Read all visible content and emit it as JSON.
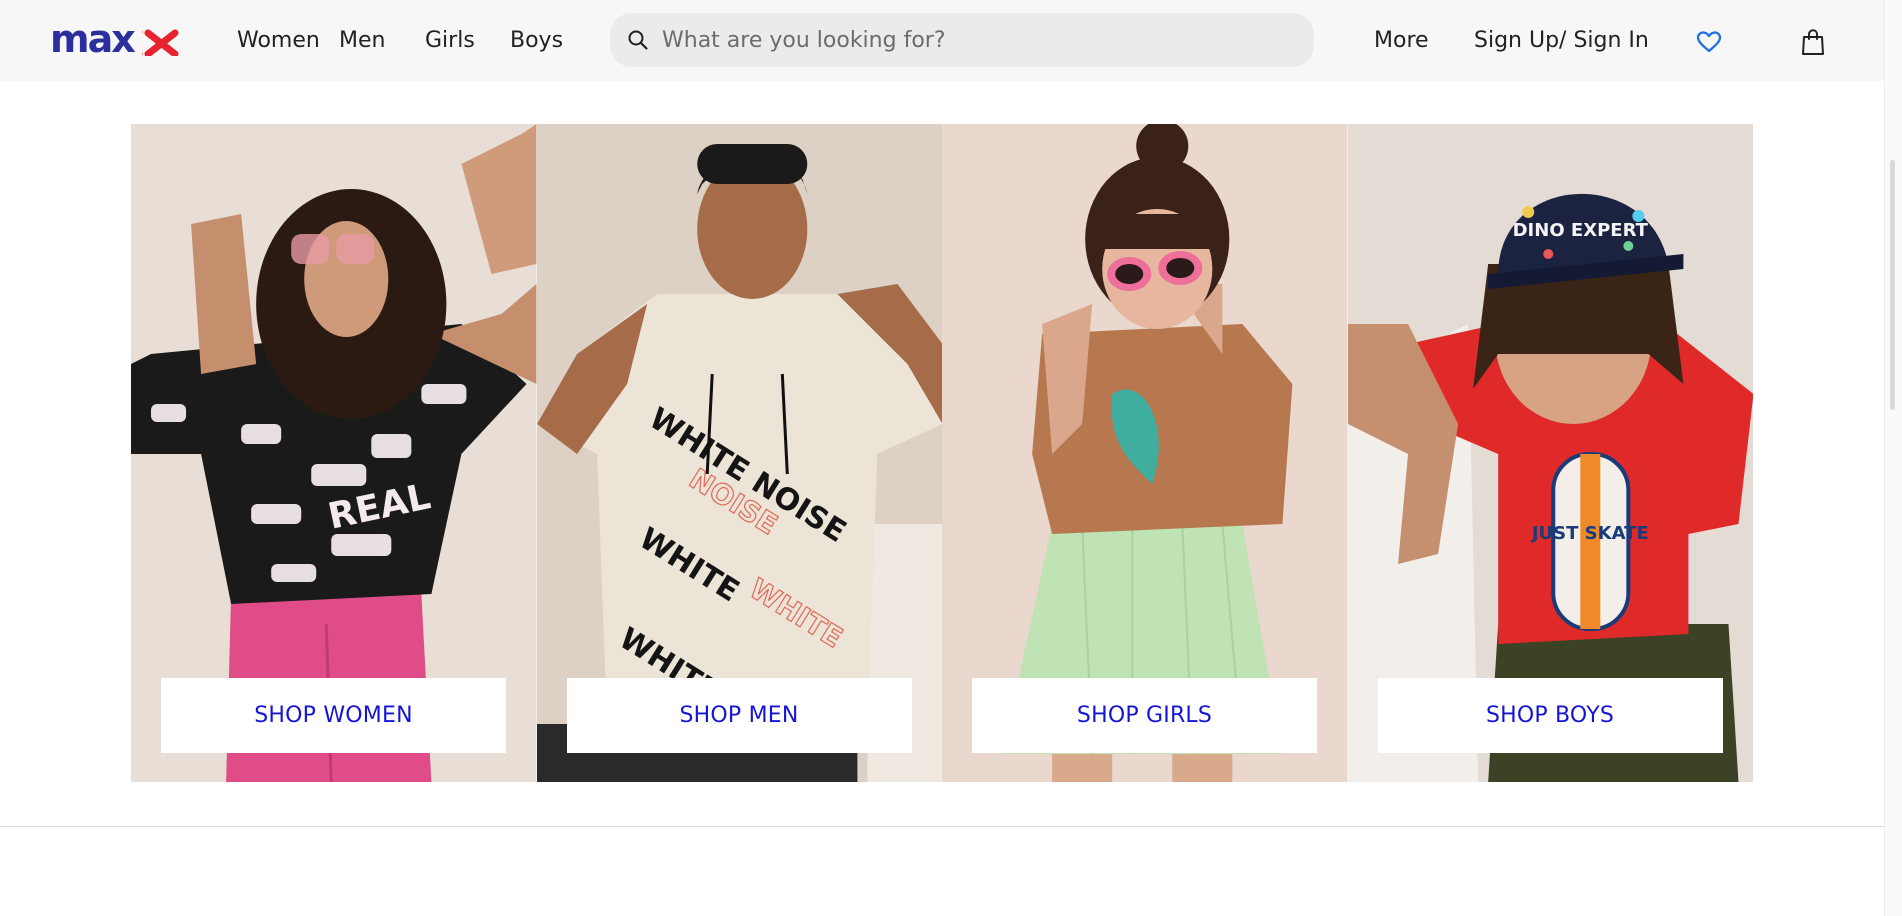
{
  "header": {
    "logo_text": "max",
    "nav": [
      {
        "label": "Women"
      },
      {
        "label": "Men"
      },
      {
        "label": "Girls"
      },
      {
        "label": "Boys"
      }
    ],
    "search": {
      "placeholder": "What are you looking for?",
      "value": ""
    },
    "more_label": "More",
    "signin_label": "Sign Up/ Sign In",
    "icons": {
      "search": "search-icon",
      "wishlist": "heart-icon",
      "cart": "shopping-bag-icon"
    }
  },
  "tiles": [
    {
      "button_label": "SHOP WOMEN",
      "print_text": "REAL"
    },
    {
      "button_label": "SHOP MEN",
      "print_text": "WHITE NOISE"
    },
    {
      "button_label": "SHOP GIRLS"
    },
    {
      "button_label": "SHOP BOYS",
      "cap_text": "DINO EXPERT",
      "tee_text": "JUST SKATE"
    }
  ],
  "colors": {
    "brand": "#2b2f9e",
    "brand_accent": "#e8232f",
    "link_blue": "#1515d6",
    "heart_blue": "#1e6fe0",
    "header_bg": "#f7f7f7",
    "search_bg": "#ebebeb"
  }
}
